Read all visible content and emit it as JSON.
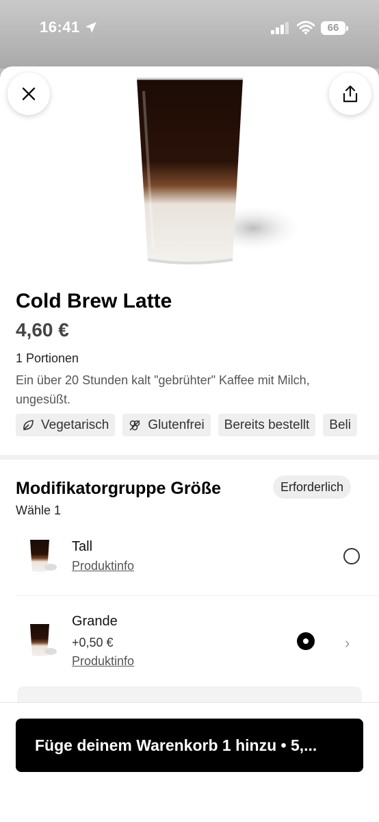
{
  "status_bar": {
    "time": "16:41",
    "battery": "66"
  },
  "product": {
    "name": "Cold Brew Latte",
    "price": "4,60 €",
    "portions": "1 Portionen",
    "description": "Ein über 20 Stunden kalt \"gebrühter\" Kaffee mit Milch, ungesüßt.",
    "tags": [
      {
        "label": "Vegetarisch",
        "icon": "leaf-icon"
      },
      {
        "label": "Glutenfrei",
        "icon": "wheat-icon"
      },
      {
        "label": "Bereits bestellt"
      },
      {
        "label": "Beli"
      }
    ]
  },
  "modifier_group": {
    "title": "Modifikatorgruppe Größe",
    "required_label": "Erforderlich",
    "choose_label": "Wähle 1",
    "options": [
      {
        "name": "Tall",
        "info_link": "Produktinfo",
        "selected": false
      },
      {
        "name": "Grande",
        "price": "+0,50 €",
        "info_link": "Produktinfo",
        "selected": true
      }
    ]
  },
  "footer": {
    "cta_label": "Füge deinem Warenkorb 1 hinzu  • 5,..."
  },
  "colors": {
    "cta_background": "#000000",
    "tag_background": "#efefef"
  }
}
